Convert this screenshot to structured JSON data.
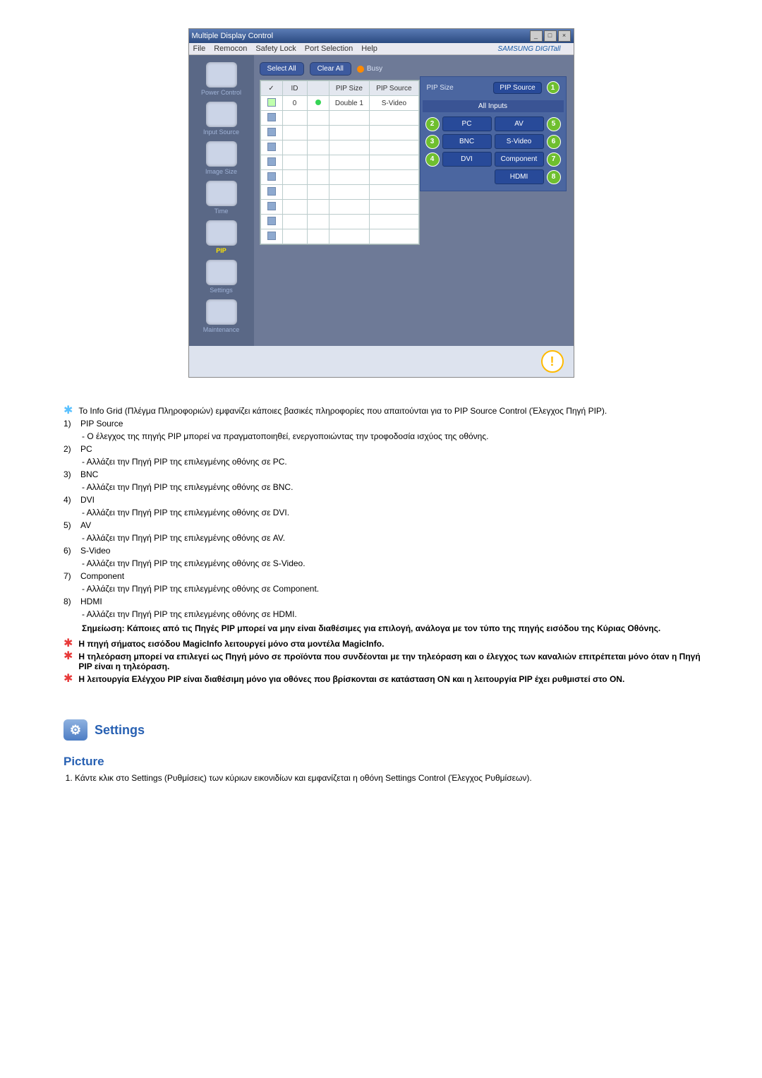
{
  "window": {
    "title": "Multiple Display Control",
    "menu": [
      "File",
      "Remocon",
      "Safety Lock",
      "Port Selection",
      "Help"
    ],
    "brand": "SAMSUNG DIGITall"
  },
  "sidebar": {
    "items": [
      {
        "label": "Power Control"
      },
      {
        "label": "Input Source"
      },
      {
        "label": "Image Size"
      },
      {
        "label": "Time"
      },
      {
        "label": "PIP"
      },
      {
        "label": "Settings"
      },
      {
        "label": "Maintenance"
      }
    ]
  },
  "toolbar": {
    "select_all": "Select All",
    "clear_all": "Clear All",
    "busy": "Busy"
  },
  "grid": {
    "headers": {
      "chk": "",
      "id": "ID",
      "pwr": "",
      "pip_size": "PIP Size",
      "pip_source": "PIP Source"
    },
    "row": {
      "id": "0",
      "pip_size": "Double 1",
      "pip_source": "S-Video"
    }
  },
  "right_panel": {
    "header_left": "PIP Size",
    "header_btn": "PIP Source",
    "header_badge": "1",
    "sub": "All Inputs",
    "cells": {
      "n2": "2",
      "pc": "PC",
      "av": "AV",
      "n5": "5",
      "n3": "3",
      "bnc": "BNC",
      "svideo": "S-Video",
      "n6": "6",
      "n4": "4",
      "dvi": "DVI",
      "component": "Component",
      "n7": "7",
      "hdmi": "HDMI",
      "n8": "8"
    }
  },
  "doc": {
    "intro": "Το Info Grid (Πλέγμα Πληροφοριών) εμφανίζει κάποιες βασικές πληροφορίες που απαιτούνται για το PIP Source Control (Έλεγχος Πηγή PIP).",
    "items": [
      {
        "n": "1)",
        "t": "PIP Source",
        "d": "- Ο έλεγχος της πηγής PIP μπορεί να πραγματοποιηθεί, ενεργοποιώντας την τροφοδοσία ισχύος της οθόνης."
      },
      {
        "n": "2)",
        "t": "PC",
        "d": "- Αλλάζει την Πηγή PIP της επιλεγμένης οθόνης σε PC."
      },
      {
        "n": "3)",
        "t": "BNC",
        "d": "- Αλλάζει την Πηγή PIP της επιλεγμένης οθόνης σε BNC."
      },
      {
        "n": "4)",
        "t": "DVI",
        "d": "- Αλλάζει την Πηγή PIP της επιλεγμένης οθόνης σε DVI."
      },
      {
        "n": "5)",
        "t": "AV",
        "d": "- Αλλάζει την Πηγή PIP της επιλεγμένης οθόνης σε AV."
      },
      {
        "n": "6)",
        "t": "S-Video",
        "d": "- Αλλάζει την Πηγή PIP της επιλεγμένης οθόνης σε S-Video."
      },
      {
        "n": "7)",
        "t": "Component",
        "d": "- Αλλάζει την Πηγή PIP της επιλεγμένης οθόνης σε Component."
      },
      {
        "n": "8)",
        "t": "HDMI",
        "d": "- Αλλάζει την Πηγή PIP της επιλεγμένης οθόνης σε HDMI."
      }
    ],
    "note": "Σημείωση: Κάποιες από τις Πηγές PIP μπορεί να μην είναι διαθέσιμες για επιλογή, ανάλογα με τον τύπο της πηγής εισόδου της Κύριας Οθόνης.",
    "bullets": [
      "Η πηγή σήματος εισόδου MagicInfo λειτουργεί μόνο στα μοντέλα MagicInfo.",
      "Η τηλεόραση μπορεί να επιλεγεί ως Πηγή μόνο σε προϊόντα που συνδέονται με την τηλεόραση και ο έλεγχος των καναλιών επιτρέπεται μόνο όταν η Πηγή PIP είναι η τηλεόραση.",
      "Η λειτουργία Ελέγχου PIP είναι διαθέσιμη μόνο για οθόνες που βρίσκονται σε κατάσταση ON και η λειτουργία PIP έχει ρυθμιστεί στο ON."
    ],
    "settings_heading": "Settings",
    "picture_heading": "Picture",
    "picture_step": "Κάντε κλικ στο Settings (Ρυθμίσεις) των κύριων εικονιδίων και εμφανίζεται η οθόνη Settings Control (Έλεγχος Ρυθμίσεων)."
  }
}
